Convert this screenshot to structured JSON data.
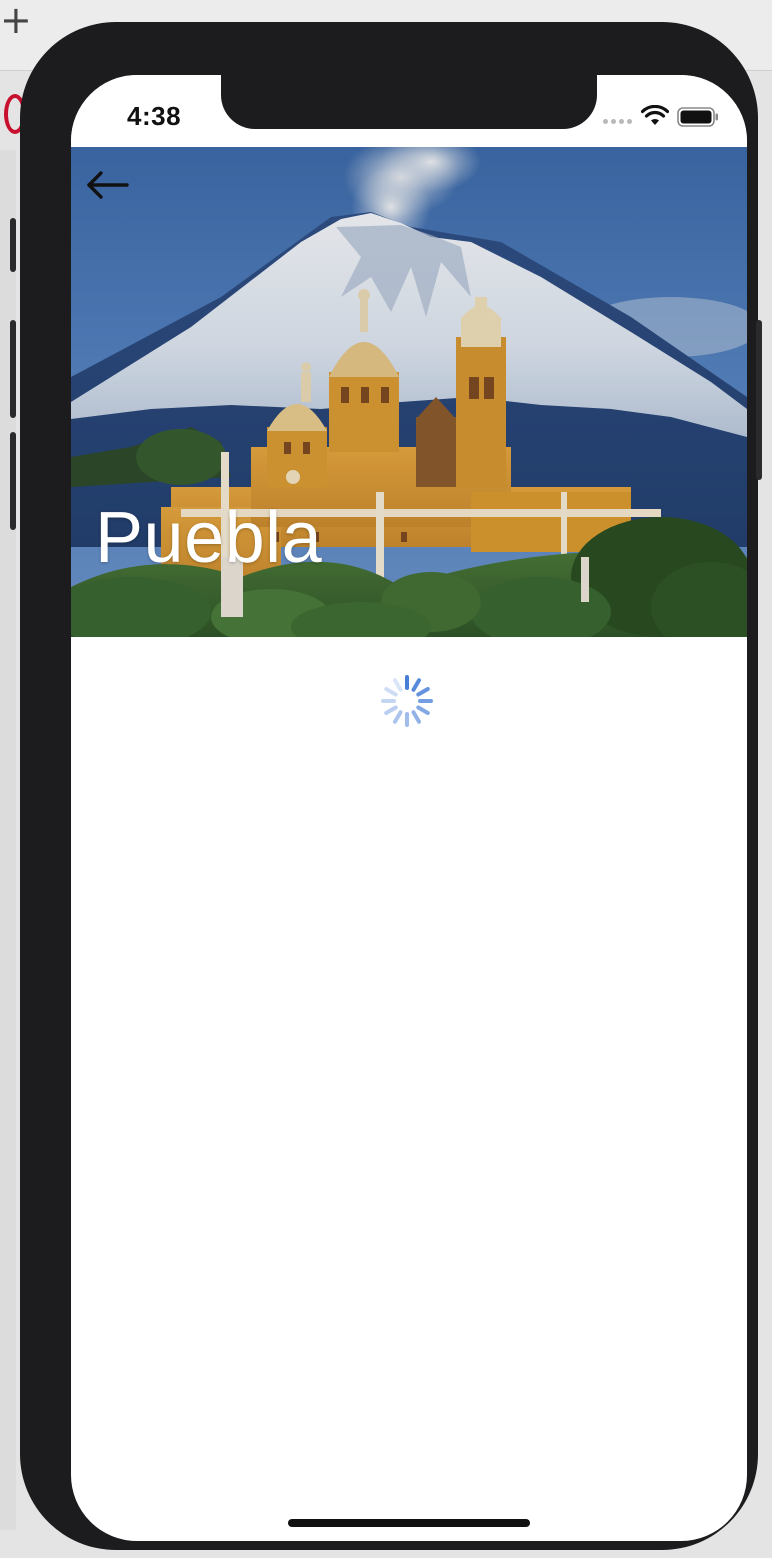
{
  "status_bar": {
    "time": "4:38"
  },
  "header": {
    "back_icon": "arrow-left-icon",
    "title": "Puebla",
    "hero_image": "volcano-and-church-photo"
  },
  "content": {
    "loading_indicator": "spinner-icon"
  },
  "colors": {
    "title_text": "#ffffff",
    "spinner": "#4a7fd8",
    "device_frame": "#1c1c1e"
  }
}
